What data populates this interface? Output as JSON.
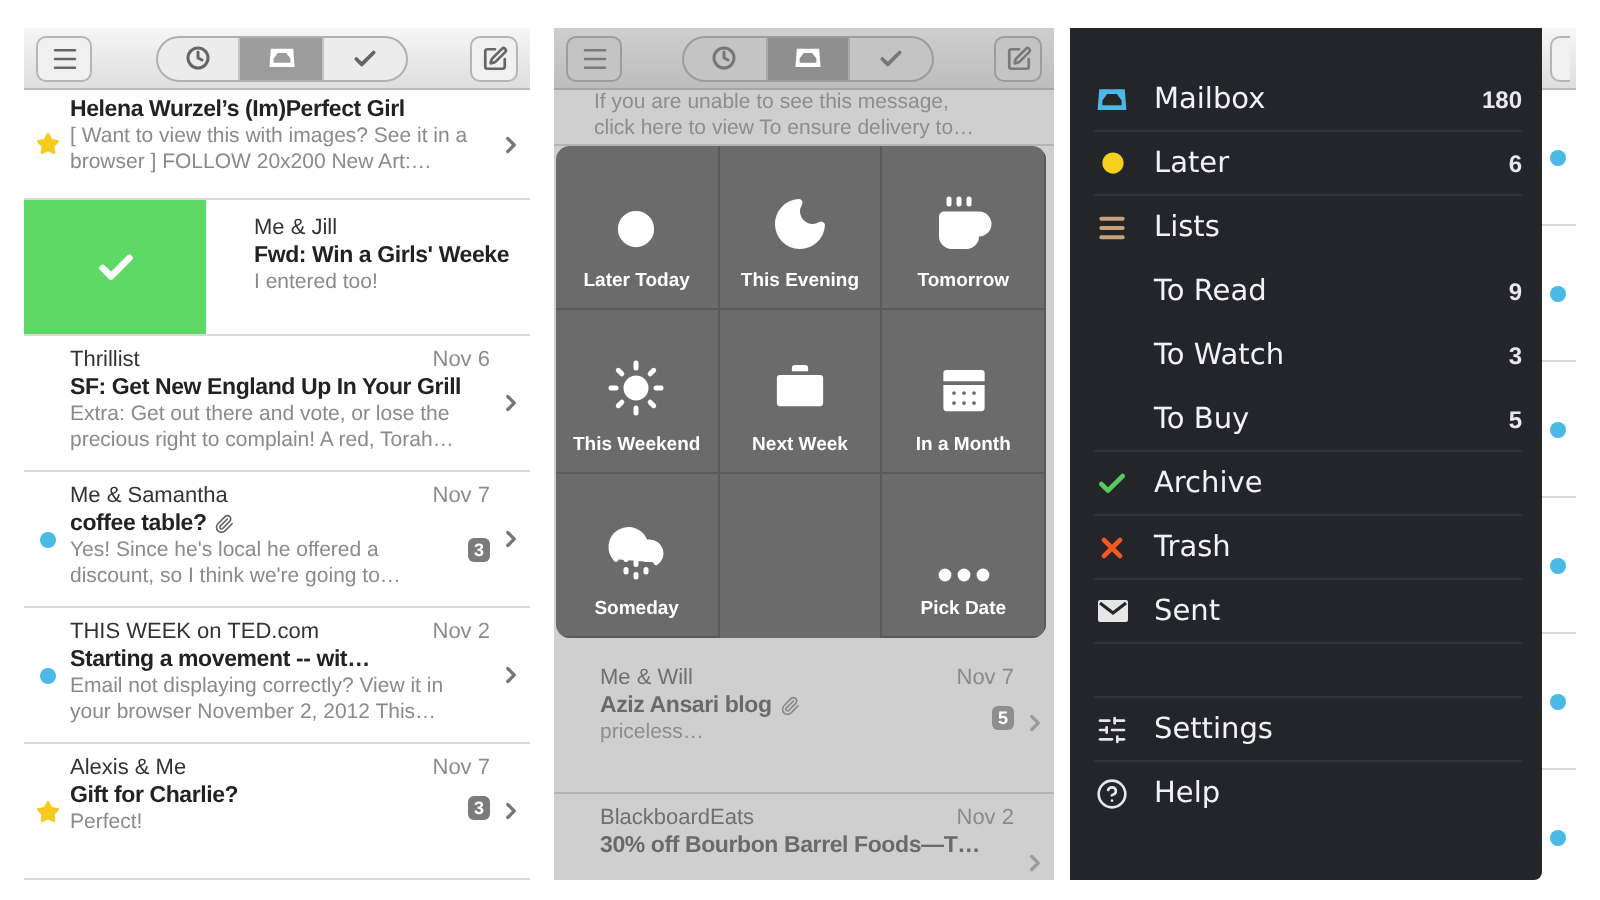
{
  "left_screen": {
    "toolbar": {
      "segments": [
        {
          "selected": false
        },
        {
          "selected": true
        },
        {
          "selected": false
        }
      ]
    },
    "messages": [
      {
        "kind": "mail",
        "subject": "Helena Wurzel’s (Im)Perfect Girl",
        "preview": "[ Want to view this with images? See it in a browser ] FOLLOW 20x200 New Art:…",
        "starred": true,
        "unread": false,
        "attachment": false
      },
      {
        "kind": "swiped",
        "sender": "Me & Jill",
        "subject": "Fwd: Win a Girls' Weeke",
        "preview": "I entered too!"
      },
      {
        "kind": "mail",
        "sender": "Thrillist",
        "date": "Nov 6",
        "subject": "SF: Get New England Up In Your Grill",
        "preview": "Extra: Get out there and vote, or lose the precious right to complain! A red, Torah…",
        "starred": false,
        "unread": false,
        "attachment": false
      },
      {
        "kind": "mail",
        "sender": "Me & Samantha",
        "date": "Nov 7",
        "subject": "coffee table?",
        "preview": "Yes! Since he's local he offered a discount, so I think we're going to…",
        "starred": false,
        "unread": true,
        "attachment": true,
        "count": "3"
      },
      {
        "kind": "mail",
        "sender": "THIS WEEK on TED.com",
        "date": "Nov 2",
        "subject": "Starting a movement -- wit…",
        "preview": "Email not displaying correctly? View it in your browser November 2, 2012 This…",
        "starred": false,
        "unread": true,
        "attachment": false
      },
      {
        "kind": "mail",
        "sender": "Alexis & Me",
        "date": "Nov 7",
        "subject": "Gift for Charlie?",
        "preview": "Perfect!",
        "starred": true,
        "unread": false,
        "attachment": false,
        "count": "3"
      }
    ]
  },
  "middle_screen": {
    "toolbar": {
      "segments": [
        {
          "selected": false
        },
        {
          "selected": true
        },
        {
          "selected": false
        }
      ]
    },
    "top_preview": "If you are unable to see this message, click here to view To ensure delivery to…",
    "snooze_options": [
      {
        "label": "Later Today"
      },
      {
        "label": "This Evening"
      },
      {
        "label": "Tomorrow"
      },
      {
        "label": "This Weekend"
      },
      {
        "label": "Next Week"
      },
      {
        "label": "In a Month"
      },
      {
        "label": "Someday"
      },
      {
        "label": "Pick Date"
      }
    ],
    "messages": [
      {
        "kind": "mail",
        "sender": "Me & Will",
        "date": "Nov 7",
        "subject": "Aziz Ansari blog",
        "preview": "priceless…",
        "starred": false,
        "unread": false,
        "attachment": true,
        "count": "5"
      },
      {
        "kind": "mail",
        "sender": "BlackboardEats",
        "date": "Nov 2",
        "subject": "30% off Bourbon Barrel Foods—T…",
        "starred": false,
        "unread": false,
        "attachment": false
      }
    ]
  },
  "right_screen": {
    "menu": [
      {
        "label": "Mailbox",
        "count": "180"
      },
      {
        "label": "Later",
        "count": "6"
      },
      {
        "label": "Lists",
        "children": [
          {
            "label": "To Read",
            "count": "9"
          },
          {
            "label": "To Watch",
            "count": "3"
          },
          {
            "label": "To Buy",
            "count": "5"
          }
        ]
      },
      {
        "label": "Archive"
      },
      {
        "label": "Trash"
      },
      {
        "label": "Sent"
      }
    ],
    "footer_menu": [
      {
        "label": "Settings"
      },
      {
        "label": "Help"
      }
    ],
    "peek_rows": [
      {
        "unread": true
      },
      {
        "unread": true
      },
      {
        "unread": true
      },
      {
        "unread": true
      },
      {
        "unread": true
      },
      {
        "unread": true
      }
    ]
  }
}
